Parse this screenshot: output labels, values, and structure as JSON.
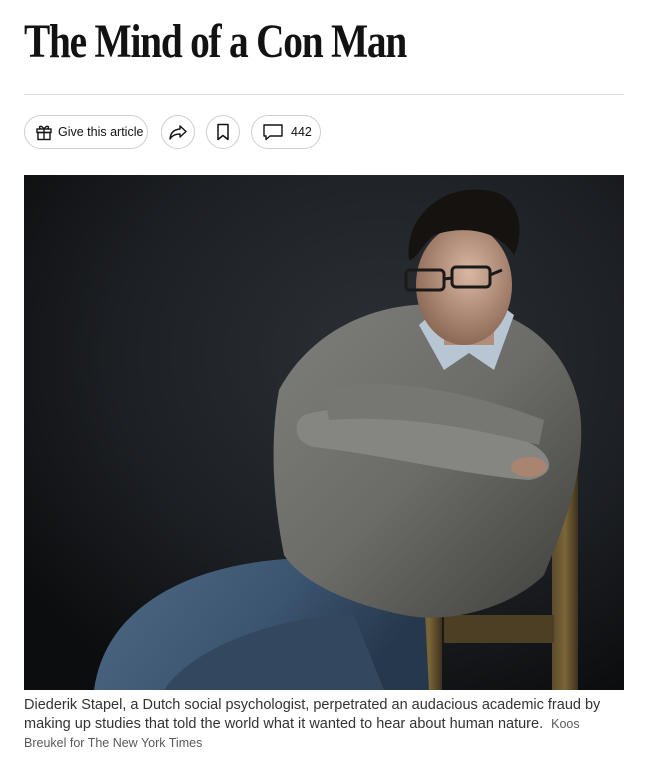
{
  "article": {
    "title": "The Mind of a Con Man"
  },
  "toolbar": {
    "gift_label": "Give this article",
    "gift_icon": "gift-icon",
    "share_icon": "share-arrow-icon",
    "save_icon": "bookmark-icon",
    "comments_icon": "comment-bubble-icon",
    "comment_count": "442"
  },
  "photo": {
    "caption": "Diederik Stapel, a Dutch social psychologist, perpetrated an audacious academic fraud by making up studies that told the world what it wanted to hear about human nature.",
    "credit": "Koos Breukel for The New York Times"
  },
  "colors": {
    "text": "#121212",
    "rule": "#dfdfdf",
    "pill_border": "#cfcfcf",
    "caption": "#333333",
    "credit": "#5a5a5a"
  }
}
